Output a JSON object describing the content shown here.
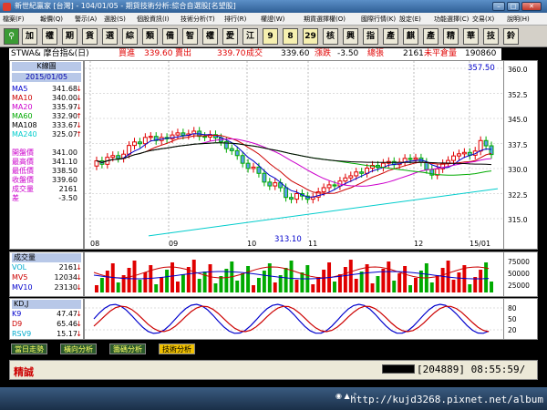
{
  "window": {
    "title": "新世紀贏家 [台灣] - 104/01/05 - 期貨技術分析:綜合自選股[名望股]"
  },
  "menu": [
    "檔案(F)",
    "報價(Q)",
    "警示(A)",
    "選股(S)",
    "個股資訊(I)",
    "技術分析(T)",
    "排行(R)",
    "權證(W)",
    "期貨選擇權(O)",
    "國際行情(K)",
    "設定(E)",
    "功能選擇(C)",
    "交易(X)",
    "說明(H)"
  ],
  "toolbar": [
    "加",
    "權",
    "期",
    "貨",
    "選",
    "綜",
    "類",
    "備",
    "智",
    "權",
    "愛",
    "江",
    "9",
    "8",
    "29",
    "核",
    "興",
    "指",
    "產",
    "麒",
    "產",
    "精",
    "華",
    "技",
    "鈴"
  ],
  "quote": {
    "symbol": "STWA& 摩台指&(日)",
    "bid_label": "買進",
    "bid": "339.60",
    "ask_label": "賣出",
    "ask": "339.70",
    "deal_label": "成交",
    "deal": "339.60",
    "change_label": "漲跌",
    "change": "-3.50",
    "volume_label": "總張",
    "volume": "2161",
    "oi_label": "未平倉量",
    "oi": "190860"
  },
  "left_panel": {
    "header": "K線圖",
    "date": "2015/01/05",
    "ma": [
      {
        "name": "MA5",
        "value": "341.68",
        "arrow": "↓",
        "color": "#0000cc"
      },
      {
        "name": "MA10",
        "value": "340.00",
        "arrow": "↓",
        "color": "#cc0000"
      },
      {
        "name": "MA20",
        "value": "335.97",
        "arrow": "↓",
        "color": "#cc00cc"
      },
      {
        "name": "MA60",
        "value": "332.90",
        "arrow": "↑",
        "color": "#00aa00"
      },
      {
        "name": "MA108",
        "value": "333.67",
        "arrow": "↓",
        "color": "#000000"
      },
      {
        "name": "MA240",
        "value": "325.07",
        "arrow": "↑",
        "color": "#00cccc"
      }
    ],
    "ohlc": [
      {
        "name": "開盤價",
        "value": "341.00"
      },
      {
        "name": "最高價",
        "value": "341.10"
      },
      {
        "name": "最低價",
        "value": "338.50"
      },
      {
        "name": "收盤價",
        "value": "339.60"
      },
      {
        "name": "成交量",
        "value": "2161"
      },
      {
        "name": "差",
        "value": "-3.50"
      }
    ]
  },
  "volume_panel": {
    "header": "成交量",
    "rows": [
      {
        "name": "VOL",
        "value": "2161",
        "arrow": "↓",
        "color": "#00aacc"
      },
      {
        "name": "MV5",
        "value": "12034",
        "arrow": "↓",
        "color": "#cc0000"
      },
      {
        "name": "MV10",
        "value": "23130",
        "arrow": "↓",
        "color": "#0000cc"
      }
    ],
    "axis": [
      "75000",
      "50000",
      "25000"
    ]
  },
  "kd_panel": {
    "header": "KD,J",
    "rows": [
      {
        "name": "K9",
        "value": "47.47",
        "arrow": "↓",
        "color": "#0000cc"
      },
      {
        "name": "D9",
        "value": "65.46",
        "arrow": "↓",
        "color": "#cc0000"
      },
      {
        "name": "RSV9",
        "value": "15.17",
        "arrow": "↓",
        "color": "#00aacc"
      }
    ],
    "axis": [
      "80",
      "50",
      "20"
    ]
  },
  "chart_labels": {
    "high": "357.50",
    "low": "313.10",
    "months": [
      "08",
      "09",
      "10",
      "11",
      "12",
      "15/01"
    ],
    "yticks": [
      "360.0",
      "352.5",
      "345.0",
      "337.5",
      "330.0",
      "322.5",
      "315.0"
    ]
  },
  "tabs": [
    "當日走勢",
    "橫向分析",
    "籌碼分析",
    "技術分析"
  ],
  "status": {
    "label": "精誠",
    "value": "204889",
    "time": "08:55:59/"
  },
  "watermark": "http://kujd3268.pixnet.net/album",
  "colors": {
    "up": "#e00000",
    "down": "#0000cc",
    "ma5": "#0000cc",
    "ma10": "#cc0000",
    "ma20": "#cc00cc",
    "ma60": "#00aa00",
    "ma108": "#000000",
    "ma240": "#00cccc"
  }
}
